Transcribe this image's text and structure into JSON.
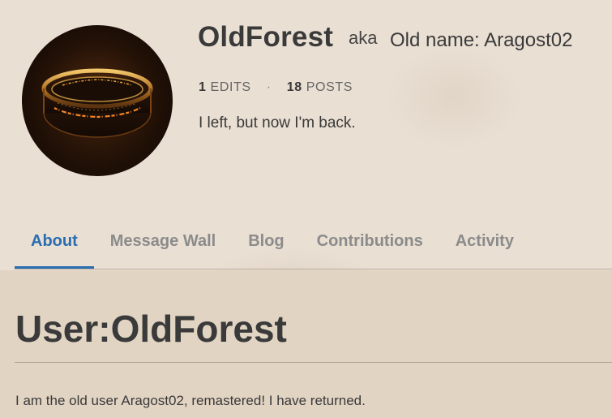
{
  "profile": {
    "username": "OldForest",
    "aka_label": "aka",
    "aka_value": "Old name: Aragost02",
    "edits_count": "1",
    "edits_label": "EDITS",
    "separator": "·",
    "posts_count": "18",
    "posts_label": "POSTS",
    "bio": "I left, but now I'm back.",
    "avatar_icon": "one-ring-avatar"
  },
  "tabs": [
    {
      "label": "About",
      "active": true
    },
    {
      "label": "Message Wall",
      "active": false
    },
    {
      "label": "Blog",
      "active": false
    },
    {
      "label": "Contributions",
      "active": false
    },
    {
      "label": "Activity",
      "active": false
    }
  ],
  "page": {
    "title": "User:OldForest",
    "body": "I am the old user Aragost02, remastered! I have returned."
  },
  "colors": {
    "accent": "#2a6db0",
    "text": "#3a3a3a",
    "muted": "#8b8b8b",
    "background": "#e9dfd3"
  }
}
